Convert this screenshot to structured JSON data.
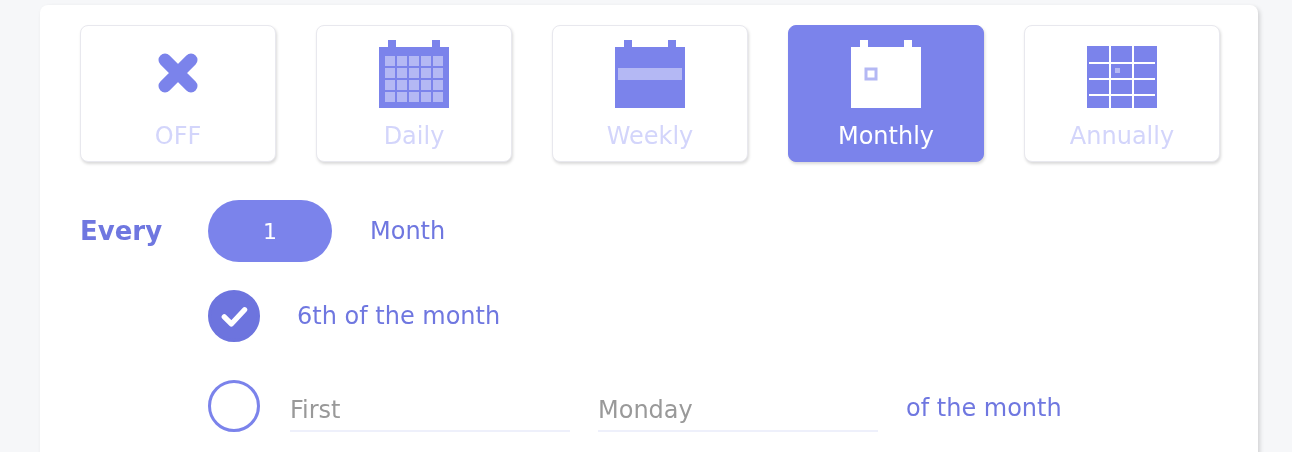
{
  "frequency_tabs": [
    {
      "label": "OFF",
      "kind": "off",
      "selected": false
    },
    {
      "label": "Daily",
      "kind": "daily",
      "selected": false
    },
    {
      "label": "Weekly",
      "kind": "weekly",
      "selected": false
    },
    {
      "label": "Monthly",
      "kind": "monthly",
      "selected": true
    },
    {
      "label": "Annually",
      "kind": "annually",
      "selected": false
    }
  ],
  "every": {
    "label": "Every",
    "value": "1",
    "unit": "Month"
  },
  "options": [
    {
      "kind": "text",
      "selected": true,
      "label": "6th of the month"
    },
    {
      "kind": "fields",
      "selected": false,
      "ordinal": {
        "placeholder": "First"
      },
      "weekday": {
        "placeholder": "Monday"
      },
      "suffix": "of the month"
    }
  ]
}
